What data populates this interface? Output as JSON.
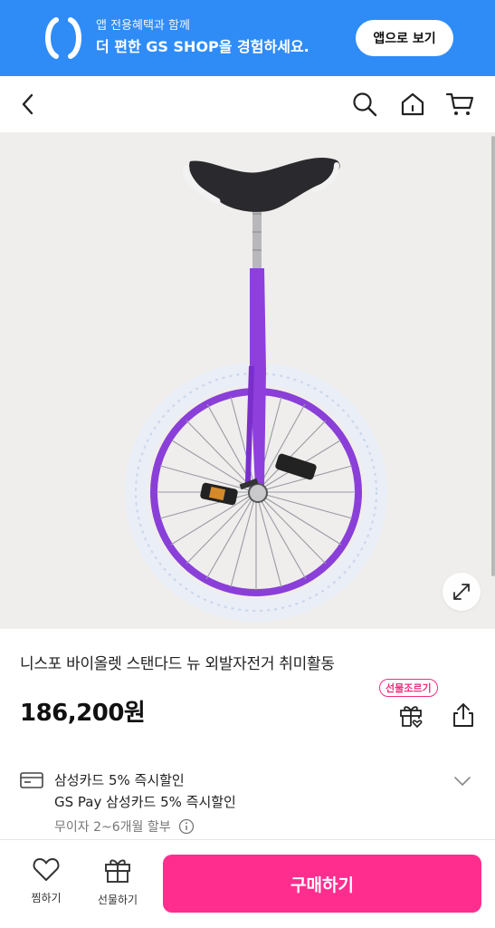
{
  "app_banner": {
    "line1": "앱 전용혜택과 함께",
    "line2": "더 편한 GS SHOP을 경험하세요.",
    "open_app_label": "앱으로 보기",
    "background_color": "#2f8cf7"
  },
  "top_nav": {
    "back_icon": "chevron-left-icon",
    "search_icon": "search-icon",
    "home_icon": "home-icon",
    "cart_icon": "cart-icon"
  },
  "product": {
    "image_subject": "unicycle",
    "title": "니스포 바이올렛 스탠다드 뉴 외발자전거 취미활동",
    "price": "186,200원",
    "gift_badge": "선물조르기",
    "accent_color": "#ef2f7f"
  },
  "benefits": {
    "line1": "삼성카드 5% 즉시할인",
    "line2": "GS Pay 삼성카드 5% 즉시할인",
    "installment": "무이자 2~6개월 할부"
  },
  "bottom_bar": {
    "wishlist_label": "찜하기",
    "gift_label": "선물하기",
    "buy_label": "구매하기",
    "buy_color": "#ff2d8e"
  }
}
